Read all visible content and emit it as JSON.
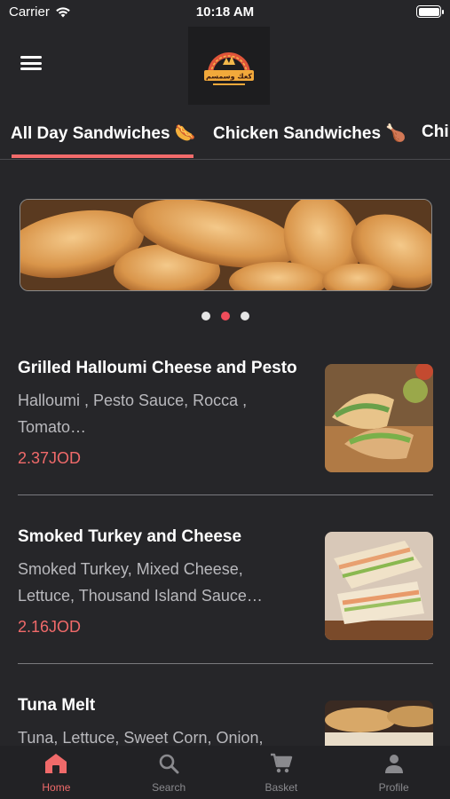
{
  "status_bar": {
    "carrier": "Carrier",
    "time": "10:18 AM"
  },
  "header": {
    "logo_text": "كعك وسمسم"
  },
  "tabs": [
    {
      "label": "All Day Sandwiches 🌭",
      "active": true
    },
    {
      "label": "Chicken Sandwiches 🍗",
      "active": false
    },
    {
      "label": "Chi",
      "active": false
    }
  ],
  "carousel": {
    "page_count": 3,
    "active_page": 2
  },
  "items": [
    {
      "name": "Grilled Halloumi Cheese and Pesto",
      "description": "Halloumi , Pesto Sauce, Rocca , Tomato…",
      "price": "2.37JOD"
    },
    {
      "name": "Smoked Turkey and Cheese",
      "description": "Smoked Turkey, Mixed Cheese, Lettuce, Thousand Island Sauce…",
      "price": "2.16JOD"
    },
    {
      "name": "Tuna Melt",
      "description": "Tuna, Lettuce, Sweet Corn, Onion,",
      "price": ""
    }
  ],
  "bottom_nav": [
    {
      "label": "Home",
      "icon": "home-icon",
      "active": true
    },
    {
      "label": "Search",
      "icon": "search-icon",
      "active": false
    },
    {
      "label": "Basket",
      "icon": "cart-icon",
      "active": false
    },
    {
      "label": "Profile",
      "icon": "person-icon",
      "active": false
    }
  ],
  "colors": {
    "accent": "#f06a6a",
    "active_dot": "#f04c5a",
    "background": "#262629"
  }
}
